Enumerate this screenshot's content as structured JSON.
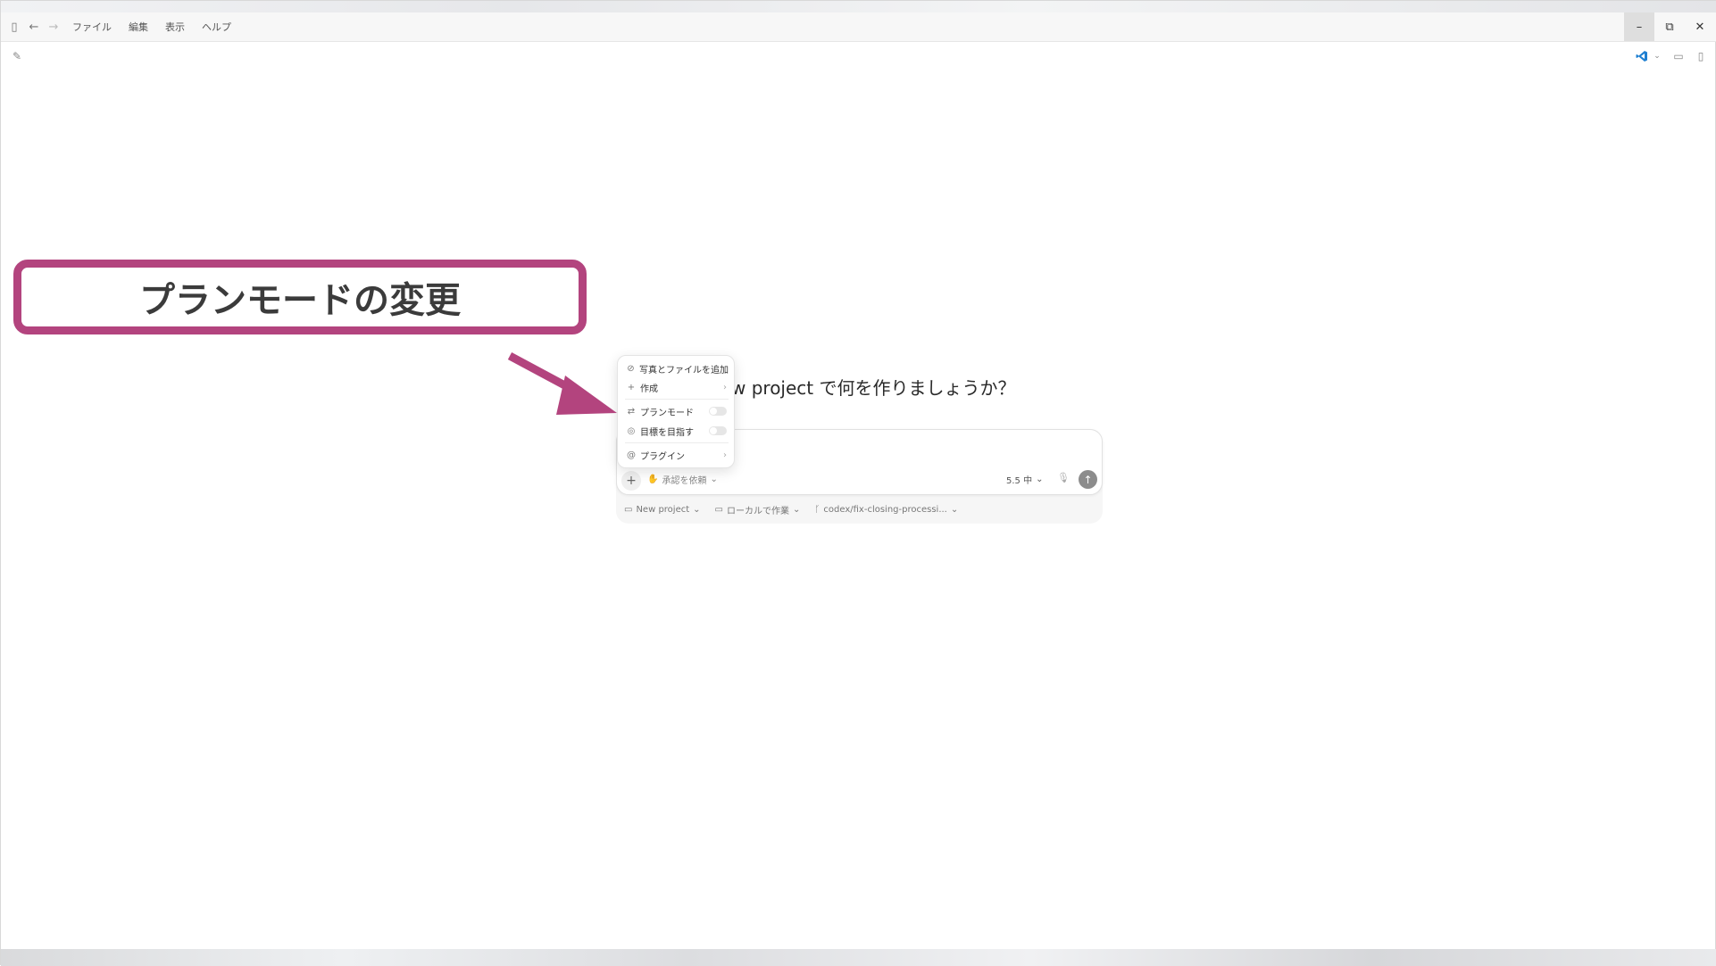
{
  "menu": {
    "items": [
      "ファイル",
      "編集",
      "表示",
      "ヘルプ"
    ]
  },
  "heading": {
    "text": "w project で何を作りましょうか？"
  },
  "popup": {
    "items": [
      {
        "icon": "paperclip-icon",
        "label": "写真とファイルを追加",
        "type": "action"
      },
      {
        "icon": "plus-icon",
        "label": "作成",
        "type": "submenu"
      },
      {
        "icon": "plan-mode-icon",
        "label": "プランモード",
        "type": "toggle",
        "on": false
      },
      {
        "icon": "target-icon",
        "label": "目標を目指す",
        "type": "toggle",
        "on": false
      },
      {
        "icon": "plugin-icon",
        "label": "プラグイン",
        "type": "submenu"
      }
    ]
  },
  "composer": {
    "approval_label": "承認を依頼",
    "model_label": "5.5 中",
    "footer": {
      "project": "New project",
      "location": "ローカルで作業",
      "branch": "codex/fix-closing-processi..."
    }
  },
  "callout": {
    "text": "プランモードの変更",
    "color": "#b3447e"
  }
}
